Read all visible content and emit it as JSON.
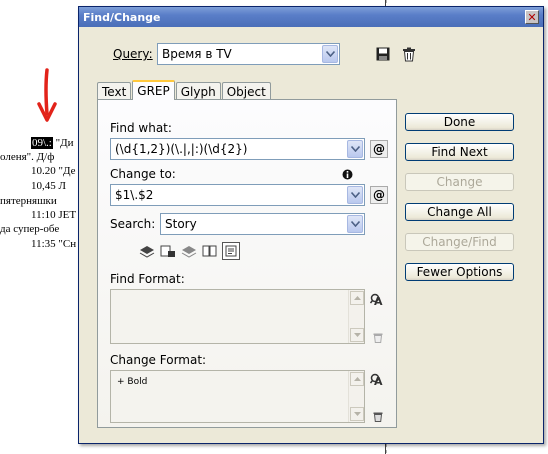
{
  "document": {
    "lines": [
      {
        "highlight": "09\\.:",
        "text": " \"Ди"
      },
      {
        "highlight": "",
        "text": "оленя\". Д/ф"
      },
      {
        "highlight": "",
        "text": "10.20 \"Де"
      },
      {
        "highlight": "",
        "text": "10,45   Л"
      },
      {
        "highlight": "",
        "text": "пятерняшки"
      },
      {
        "highlight": "",
        "text": "11:10 JET"
      },
      {
        "highlight": "",
        "text": "да супер-обе"
      },
      {
        "highlight": "",
        "text": "11:35 \"Сн"
      }
    ],
    "arrow_color": "#e2231a"
  },
  "dialog": {
    "title": "Find/Change",
    "close_glyph": "✕",
    "query_label": "Query:",
    "query_value": "Время в TV",
    "tabs": [
      {
        "label": "Text",
        "active": false
      },
      {
        "label": "GREP",
        "active": true
      },
      {
        "label": "Glyph",
        "active": false
      },
      {
        "label": "Object",
        "active": false
      }
    ],
    "find_what_label": "Find what:",
    "find_what_value": "(\\d{1,2})(\\.|,|:)(\\d{2})",
    "change_to_label": "Change to:",
    "change_to_value": "$1\\.$2",
    "search_label": "Search:",
    "search_value": "Story",
    "find_format_label": "Find Format:",
    "change_format_label": "Change Format:",
    "change_format_value": "+ Bold",
    "buttons": {
      "done": "Done",
      "find_next": "Find Next",
      "change": "Change",
      "change_all": "Change All",
      "change_find": "Change/Find",
      "fewer_options": "Fewer Options"
    },
    "icons": {
      "save_query": "save-icon",
      "delete_query": "trash-icon",
      "special_chars": "at-sign-menu-icon",
      "info": "info-icon"
    },
    "accent_color": "#0a246a",
    "tab_highlight": "#ffc83c"
  }
}
